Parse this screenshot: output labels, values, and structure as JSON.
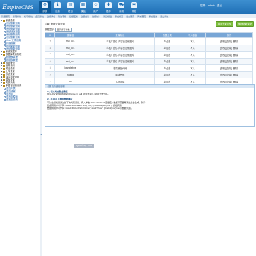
{
  "header": {
    "logo_prefix": "E",
    "logo_text": "mpireCMS",
    "user_info": "您好：admin · 退出",
    "nav": [
      {
        "label": "系统",
        "icon": "gear-icon",
        "glyph": "⚙"
      },
      {
        "label": "信息",
        "icon": "info-icon",
        "glyph": "ℹ"
      },
      {
        "label": "栏目",
        "icon": "folder-icon",
        "glyph": "▤"
      },
      {
        "label": "模板",
        "icon": "template-icon",
        "glyph": "▦"
      },
      {
        "label": "用户",
        "icon": "user-icon",
        "glyph": "☺"
      },
      {
        "label": "插件",
        "icon": "plugin-icon",
        "glyph": "✚"
      },
      {
        "label": "商城",
        "icon": "cart-icon",
        "glyph": "⛟"
      },
      {
        "label": "其他",
        "icon": "more-icon",
        "glyph": "✱"
      }
    ]
  },
  "subnav": [
    "管理首页",
    "整理系统",
    "帐号系统",
    "会员系统",
    "数据库名",
    "附加字段",
    "数据更新",
    "数据备份",
    "数据统计",
    "修改模板",
    "系统模型",
    "后台首页",
    "网站首页",
    "系统短信",
    "退出系统"
  ],
  "sidebar": {
    "items": [
      {
        "label": "系统设置",
        "level": 1,
        "open": true
      },
      {
        "label": "系统参数设置",
        "level": 2
      },
      {
        "label": "系统参数设置",
        "level": 2
      },
      {
        "label": "系统参数设置",
        "level": 2
      },
      {
        "label": "系统优化设置",
        "level": 2
      },
      {
        "label": "系统参数设置",
        "level": 2
      },
      {
        "label": "系统参数设置",
        "level": 2
      },
      {
        "label": "Jssn 文件设置",
        "level": 2
      },
      {
        "label": "扩展设置",
        "level": 2
      },
      {
        "label": "数据更新设置",
        "level": 2
      },
      {
        "label": "系统参数设置",
        "level": 2
      },
      {
        "label": "系统数据库",
        "level": 1
      },
      {
        "label": "数据库表名管理",
        "level": 1,
        "open": true
      },
      {
        "label": "数据表管理",
        "level": 2
      },
      {
        "label": "数据表管理",
        "level": 2
      },
      {
        "label": "数据备份",
        "level": 1
      },
      {
        "label": "设置访问",
        "level": 1
      },
      {
        "label": "附加设置",
        "level": 1
      },
      {
        "label": "上传设置",
        "level": 1
      },
      {
        "label": "系统设置",
        "level": 1
      },
      {
        "label": "插件系统设置",
        "level": 1
      },
      {
        "label": "模板设置",
        "level": 1
      },
      {
        "label": "内部系统",
        "level": 1
      },
      {
        "label": "多语言配置设置",
        "level": 1,
        "open": true
      },
      {
        "label": "语言列表",
        "level": 2
      },
      {
        "label": "语言设置",
        "level": 2
      },
      {
        "label": "语言包",
        "level": 2
      },
      {
        "label": "语言包模板",
        "level": 2
      },
      {
        "label": "语言包设置",
        "level": 2
      }
    ]
  },
  "main": {
    "location": "位置: 管理计数设置",
    "btn_primary": "增加计数类型",
    "btn_secondary": "管理计数类型",
    "filter_label": "数据显示:",
    "filter_value": "显示所有计数",
    "columns": [
      "ID",
      "变量名",
      "变量标识",
      "所属分类",
      "写入模板",
      "操作"
    ],
    "rows": [
      {
        "id": "9",
        "name": "mai_cc1",
        "desc": "手机广告位-内容页左侧图片",
        "cat": "单点击",
        "tpl": "写入",
        "ops": "[修改] [复制] [删除]"
      },
      {
        "id": "8",
        "name": "mai_cc1",
        "desc": "手机广告位-内容页左侧图片",
        "cat": "单点击",
        "tpl": "写入",
        "ops": "[修改] [复制] [删除]"
      },
      {
        "id": "7",
        "name": "mai_cc1",
        "desc": "手机广告位-内容页左侧图片",
        "cat": "单点击",
        "tpl": "写入",
        "ops": "[修改] [复制] [删除]"
      },
      {
        "id": "6",
        "name": "mai_cc1",
        "desc": "手机广告位-内容页左侧图片",
        "cat": "单点击",
        "tpl": "写入",
        "ops": "[修改] [复制] [删除]"
      },
      {
        "id": "5",
        "name": "kiangkelme",
        "desc": "楼端底部代码",
        "cat": "单点击",
        "tpl": "写入",
        "ops": "[修改] [复制] [删除]"
      },
      {
        "id": "2",
        "name": "footgd",
        "desc": "脚本代码",
        "cat": "单点击",
        "tpl": "写入",
        "ops": "[修改] [复制] [删除]"
      },
      {
        "id": "1",
        "name": "top",
        "desc": "TOP区域",
        "cat": "单点击",
        "tpl": "写入",
        "ops": "[修改] [复制] [删除]"
      }
    ],
    "info": {
      "title": "计数代码调用说明",
      "s1_title": "1、引入动态数据模板",
      "s1_text": "在任意js文件模板中使用[pnt]e_C_adl_3]变量名[/...]调用计数代码。",
      "s2_title": "2、在JS引入参考数据模板",
      "s2_line1": "可以在模板里通过如下的代码调用，传入参数: RebenPathUrl('变量名') 数据不需要再通过后台生成，例子:",
      "s2_line2": "数据调用参考代码: btsbd=ReisrPathTnUrl('tnsr') || btsbd(tiigtMl('tnsr')) 表格调用",
      "s2_line3": "数据调用参考代码: btsbd=RebenPathUrl('tnsr').tnsr2?('tnsr') || btsbd(tnsr('tnsr')) 数据调用。"
    }
  },
  "watermark": "myaoding.com",
  "colors": {
    "header": "#1f6fb5",
    "accent": "#7cbd3c",
    "table_head": "#78a6d6",
    "link": "#1f5fa6"
  }
}
